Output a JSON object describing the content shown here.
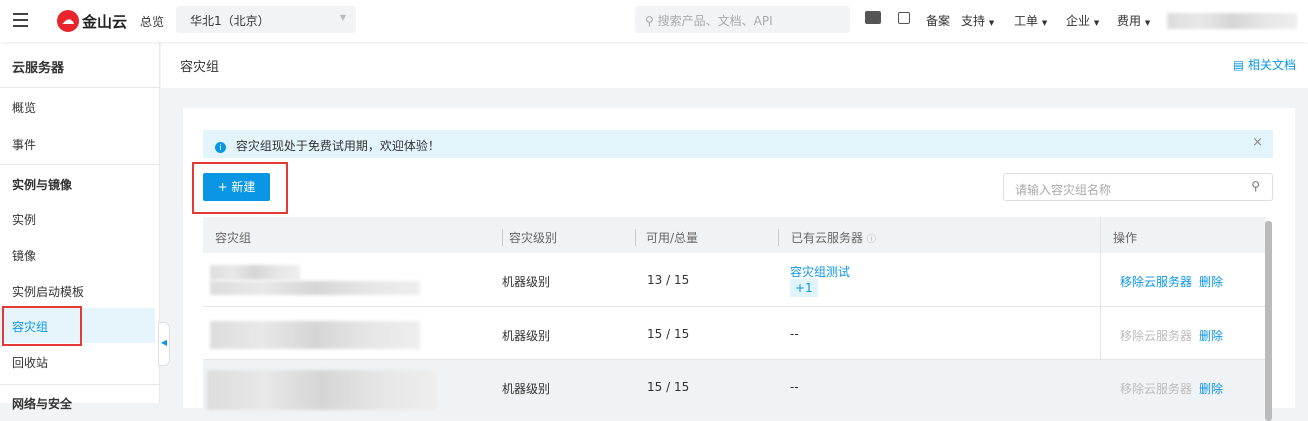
{
  "header": {
    "logo_text": "金山云",
    "overview": "总览",
    "region": "华北1（北京）",
    "search_placeholder": "搜索产品、文档、API",
    "nav": [
      "备案",
      "支持",
      "工单",
      "企业",
      "费用"
    ]
  },
  "sidebar": {
    "title": "云服务器",
    "items": [
      {
        "label": "概览"
      },
      {
        "label": "事件"
      }
    ],
    "section1": "实例与镜像",
    "section1_items": [
      {
        "label": "实例"
      },
      {
        "label": "镜像"
      },
      {
        "label": "实例启动模板"
      },
      {
        "label": "容灾组",
        "active": true
      },
      {
        "label": "回收站"
      }
    ],
    "section2": "网络与安全"
  },
  "page": {
    "title": "容灾组",
    "docs_link": "相关文档",
    "alert": "容灾组现处于免费试用期，欢迎体验！",
    "new_button": "+ 新建",
    "search_placeholder": "请输入容灾组名称"
  },
  "table": {
    "columns": [
      "容灾组",
      "容灾级别",
      "可用/总量",
      "已有云服务器",
      "操作"
    ],
    "rows": [
      {
        "level": "机器级别",
        "usage": "13 / 15",
        "servers": "容灾组测试",
        "extra": "+1",
        "remove": "移除云服务器",
        "remove_enabled": true,
        "delete": "删除"
      },
      {
        "level": "机器级别",
        "usage": "15 / 15",
        "servers": "--",
        "remove": "移除云服务器",
        "remove_enabled": false,
        "delete": "删除"
      },
      {
        "level": "机器级别",
        "usage": "15 / 15",
        "servers": "--",
        "remove": "移除云服务器",
        "remove_enabled": false,
        "delete": "删除"
      }
    ]
  },
  "colors": {
    "accent": "#0b96e5",
    "brand": "#e8242c",
    "highlight": "#e53935"
  }
}
